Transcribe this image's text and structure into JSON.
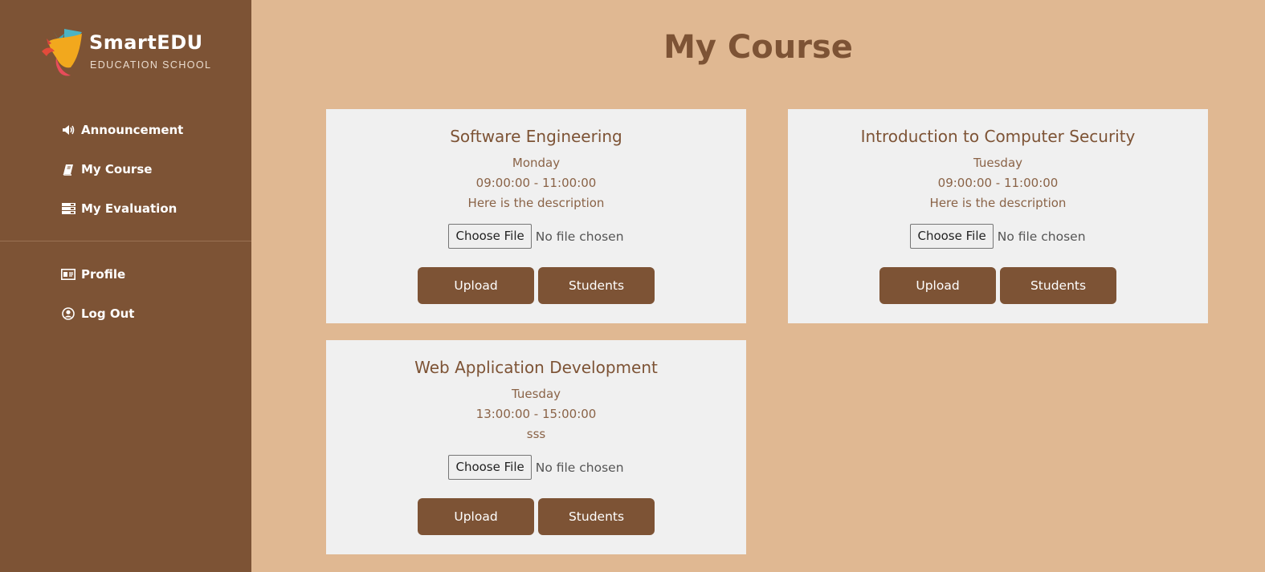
{
  "brand": {
    "name": "SmartEDU",
    "subtitle": "EDUCATION SCHOOL"
  },
  "nav": {
    "primary": [
      {
        "label": "Announcement",
        "icon": "megaphone-icon"
      },
      {
        "label": "My Course",
        "icon": "book-icon"
      },
      {
        "label": "My Evaluation",
        "icon": "list-icon"
      }
    ],
    "secondary": [
      {
        "label": "Profile",
        "icon": "id-card-icon"
      },
      {
        "label": "Log Out",
        "icon": "user-circle-icon"
      }
    ]
  },
  "page": {
    "title": "My Course"
  },
  "courses": [
    {
      "title": "Software Engineering",
      "day": "Monday",
      "time": "09:00:00 - 11:00:00",
      "description": "Here is the description",
      "file_button": "Choose File",
      "file_status": "No file chosen",
      "upload_label": "Upload",
      "students_label": "Students"
    },
    {
      "title": "Introduction to Computer Security",
      "day": "Tuesday",
      "time": "09:00:00 - 11:00:00",
      "description": "Here is the description",
      "file_button": "Choose File",
      "file_status": "No file chosen",
      "upload_label": "Upload",
      "students_label": "Students"
    },
    {
      "title": "Web Application Development",
      "day": "Tuesday",
      "time": "13:00:00 - 15:00:00",
      "description": "sss",
      "file_button": "Choose File",
      "file_status": "No file chosen",
      "upload_label": "Upload",
      "students_label": "Students"
    }
  ],
  "colors": {
    "sidebar": "#7d5335",
    "background": "#e0b892",
    "card": "#f0f0f0",
    "accent": "#7d5335"
  }
}
